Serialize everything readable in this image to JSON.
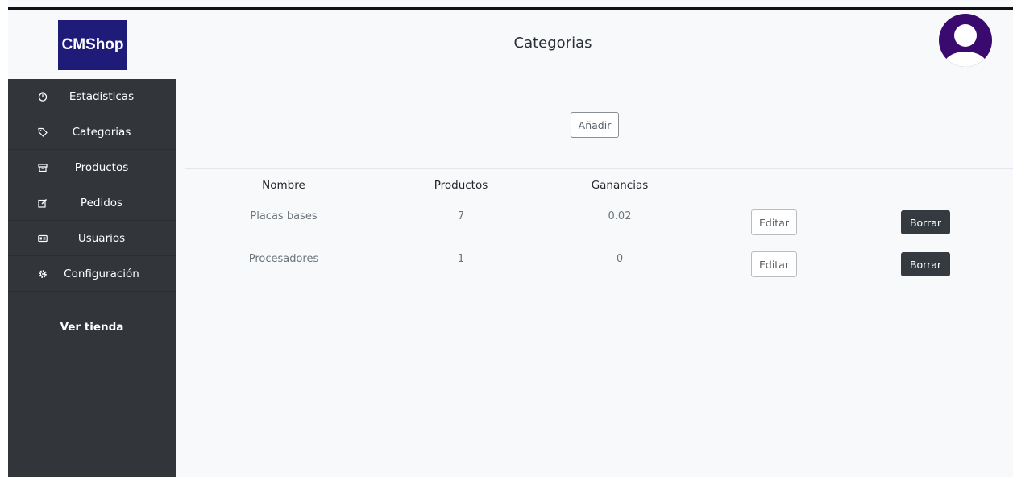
{
  "brand": {
    "logo_text": "CMShop",
    "logo_color": "#1f1b78",
    "avatar_color": "#3b0a6e"
  },
  "header": {
    "title": "Categorias"
  },
  "sidebar": {
    "items": [
      {
        "label": "Estadisticas",
        "icon": "stats-icon"
      },
      {
        "label": "Categorias",
        "icon": "tag-icon"
      },
      {
        "label": "Productos",
        "icon": "box-icon"
      },
      {
        "label": "Pedidos",
        "icon": "edit-icon"
      },
      {
        "label": "Usuarios",
        "icon": "id-card-icon"
      },
      {
        "label": "Configuración",
        "icon": "gear-icon"
      }
    ],
    "footer_link": "Ver tienda"
  },
  "main": {
    "add_label": "Añadir",
    "table": {
      "headers": [
        "Nombre",
        "Productos",
        "Ganancias"
      ],
      "rows": [
        {
          "nombre": "Placas bases",
          "productos": "7",
          "ganancias": "0.02",
          "edit": "Editar",
          "delete": "Borrar"
        },
        {
          "nombre": "Procesadores",
          "productos": "1",
          "ganancias": "0",
          "edit": "Editar",
          "delete": "Borrar"
        }
      ]
    }
  }
}
